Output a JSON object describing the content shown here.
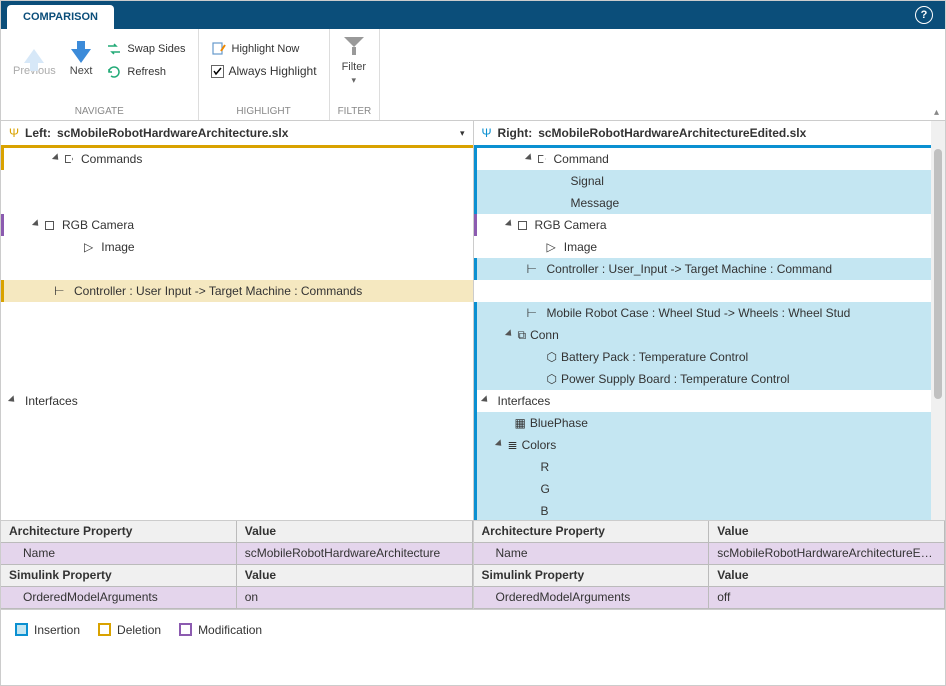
{
  "titlebar": {
    "tab": "COMPARISON"
  },
  "ribbon": {
    "navigate": {
      "previous": "Previous",
      "next": "Next",
      "swap": "Swap Sides",
      "refresh": "Refresh",
      "group": "NAVIGATE"
    },
    "highlight": {
      "now": "Highlight Now",
      "always": "Always Highlight",
      "group": "HIGHLIGHT"
    },
    "filter": {
      "label": "Filter",
      "group": "FILTER"
    }
  },
  "left": {
    "header_prefix": "Left:",
    "header_file": "scMobileRobotHardwareArchitecture.slx",
    "tree": {
      "commands": "Commands",
      "rgb": "RGB Camera",
      "image": "Image",
      "controller": "Controller : User Input -> Target Machine : Commands",
      "interfaces": "Interfaces"
    }
  },
  "right": {
    "header_prefix": "Right:",
    "header_file": "scMobileRobotHardwareArchitectureEdited.slx",
    "tree": {
      "command": "Command",
      "signal": "Signal",
      "message": "Message",
      "rgb": "RGB Camera",
      "image": "Image",
      "controller": "Controller : User_Input -> Target Machine : Command",
      "mobile": "Mobile Robot Case : Wheel Stud -> Wheels : Wheel Stud",
      "conn": "Conn",
      "battery": "Battery Pack : Temperature Control",
      "power": "Power Supply Board : Temperature Control",
      "interfaces": "Interfaces",
      "bluephase": "BluePhase",
      "colors": "Colors",
      "r": "R",
      "g": "G",
      "b": "B"
    }
  },
  "arch_table": {
    "hdr_prop": "Architecture Property",
    "hdr_val": "Value",
    "name_label": "Name",
    "left_name": "scMobileRobotHardwareArchitecture",
    "right_name": "scMobileRobotHardwareArchitectureEdit..."
  },
  "sim_table": {
    "hdr_prop": "Simulink Property",
    "hdr_val": "Value",
    "oma": "OrderedModelArguments",
    "left_val": "on",
    "right_val": "off"
  },
  "legend": {
    "insertion": "Insertion",
    "deletion": "Deletion",
    "modification": "Modification"
  }
}
